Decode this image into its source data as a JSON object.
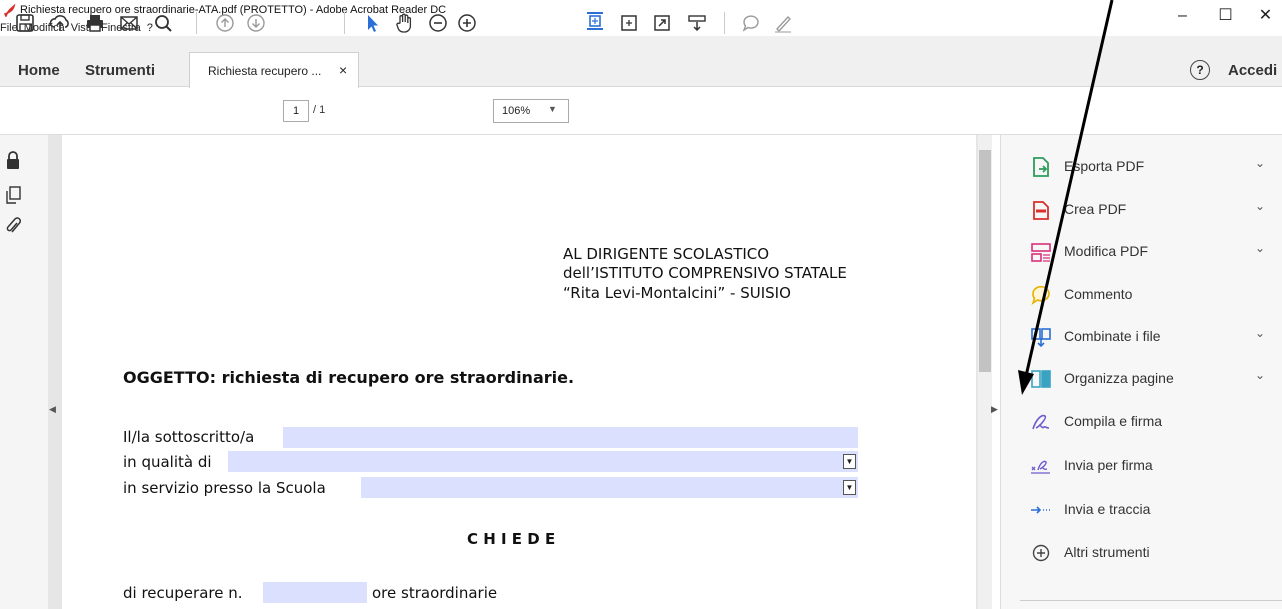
{
  "window": {
    "title": "Richiesta recupero ore straordinarie-ATA.pdf (PROTETTO) - Adobe Acrobat Reader DC",
    "min_label": "–",
    "max_label": "☐",
    "close_label": "✕"
  },
  "menu": [
    "File",
    "Modifica",
    "Vista",
    "Finestra",
    "?"
  ],
  "tabs": {
    "home": "Home",
    "tools": "Strumenti",
    "document": "Richiesta recupero ...",
    "close": "×",
    "help": "?",
    "signin": "Accedi"
  },
  "toolbar": {
    "page_current": "1",
    "page_total": "/ 1",
    "zoom": "106%"
  },
  "pdf": {
    "recipient_1": "AL DIRIGENTE SCOLASTICO",
    "recipient_2": "dell’ISTITUTO COMPRENSIVO STATALE",
    "recipient_3": "“Rita Levi-Montalcini” - SUISIO",
    "subject": "OGGETTO: richiesta di recupero ore straordinarie.",
    "label_signer": "Il/la sottoscritto/a",
    "label_role": "in qualità di",
    "label_school": "in servizio presso la Scuola",
    "requests": "C H I E D E",
    "recover_prefix": "di recuperare n.",
    "recover_suffix": "ore straordinarie",
    "signer_value": "",
    "role_value": "",
    "school_value": "",
    "hours_value": ""
  },
  "tools": [
    {
      "label": "Esporta PDF",
      "icon": "export-pdf-icon",
      "expand": true
    },
    {
      "label": "Crea PDF",
      "icon": "create-pdf-icon",
      "expand": true
    },
    {
      "label": "Modifica PDF",
      "icon": "edit-pdf-icon",
      "expand": true
    },
    {
      "label": "Commento",
      "icon": "comment-icon",
      "expand": false
    },
    {
      "label": "Combinate i file",
      "icon": "combine-files-icon",
      "expand": true
    },
    {
      "label": "Organizza pagine",
      "icon": "organize-pages-icon",
      "expand": true
    },
    {
      "label": "Compila e firma",
      "icon": "fill-sign-icon",
      "expand": false
    },
    {
      "label": "Invia per firma",
      "icon": "send-signature-icon",
      "expand": false
    },
    {
      "label": "Invia e traccia",
      "icon": "send-track-icon",
      "expand": false
    },
    {
      "label": "Altri strumenti",
      "icon": "more-tools-icon",
      "expand": false
    }
  ],
  "colors": {
    "field_fill": "#dbe0ff",
    "accent_red": "#d9302c",
    "accent_blue": "#2b6fd6",
    "accent_purple": "#6b5ccf"
  }
}
